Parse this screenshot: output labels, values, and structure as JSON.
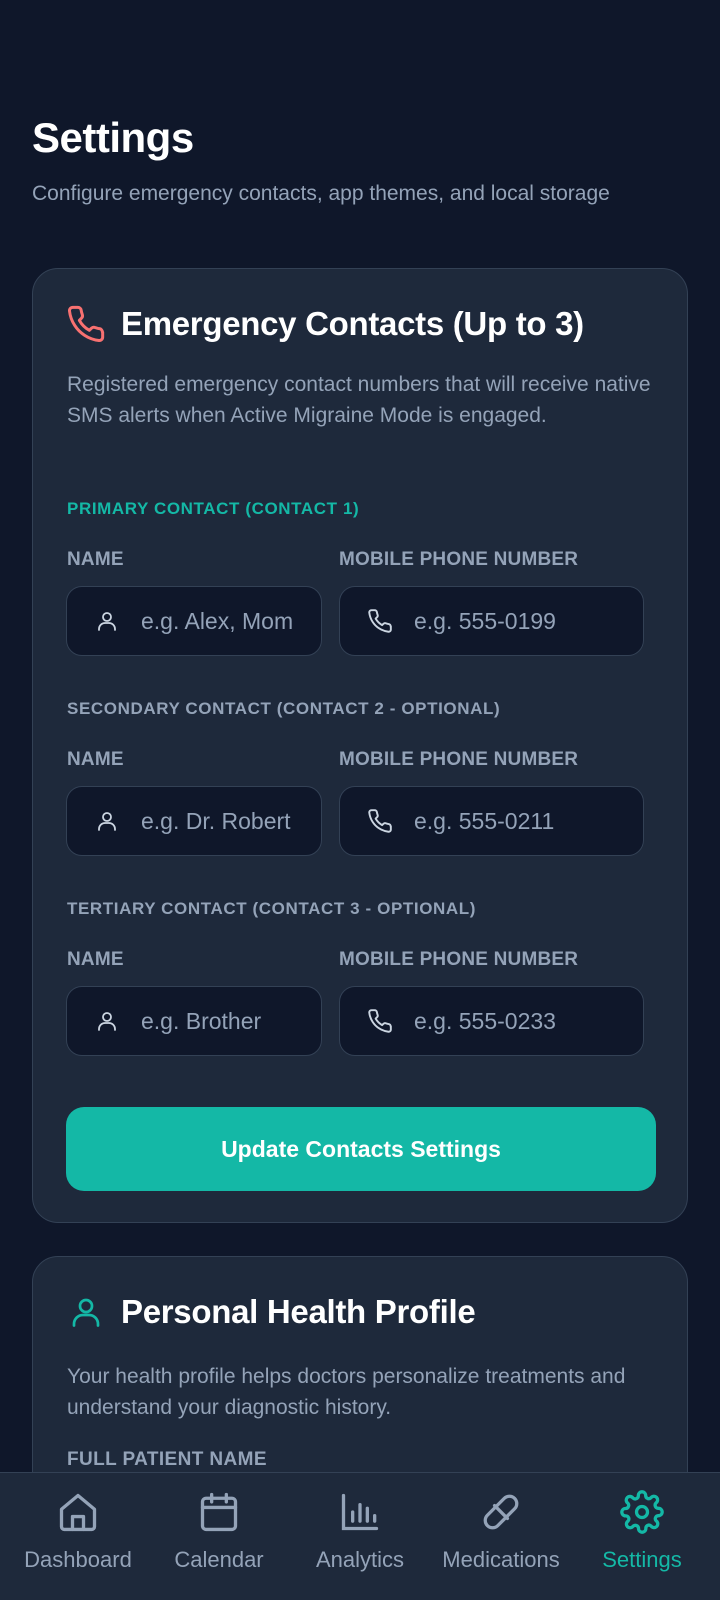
{
  "header": {
    "title": "Settings",
    "subtitle": "Configure emergency contacts, app themes, and local storage"
  },
  "emergency": {
    "title": "Emergency Contacts (Up to 3)",
    "description": "Registered emergency contact numbers that will receive native SMS alerts when Active Migraine Mode is engaged.",
    "contacts": [
      {
        "group_label": "PRIMARY CONTACT (CONTACT 1)",
        "name_label": "NAME",
        "name_placeholder": "e.g. Alex, Mom",
        "name_value": "",
        "phone_label": "MOBILE PHONE NUMBER",
        "phone_placeholder": "e.g. 555-0199",
        "phone_value": ""
      },
      {
        "group_label": "SECONDARY CONTACT (CONTACT 2 - OPTIONAL)",
        "name_label": "NAME",
        "name_placeholder": "e.g. Dr. Robert",
        "name_value": "",
        "phone_label": "MOBILE PHONE NUMBER",
        "phone_placeholder": "e.g. 555-0211",
        "phone_value": ""
      },
      {
        "group_label": "TERTIARY CONTACT (CONTACT 3 - OPTIONAL)",
        "name_label": "NAME",
        "name_placeholder": "e.g. Brother",
        "name_value": "",
        "phone_label": "MOBILE PHONE NUMBER",
        "phone_placeholder": "e.g. 555-0233",
        "phone_value": ""
      }
    ],
    "update_button": "Update Contacts Settings"
  },
  "profile": {
    "title": "Personal Health Profile",
    "description": "Your health profile helps doctors personalize treatments and understand your diagnostic history.",
    "first_field_label": "FULL PATIENT NAME"
  },
  "bottom_nav": {
    "items": [
      {
        "label": "Dashboard",
        "icon": "home-icon"
      },
      {
        "label": "Calendar",
        "icon": "calendar-icon"
      },
      {
        "label": "Analytics",
        "icon": "bar-chart-icon"
      },
      {
        "label": "Medications",
        "icon": "pill-icon"
      },
      {
        "label": "Settings",
        "icon": "gear-icon",
        "active": true
      }
    ]
  },
  "colors": {
    "background": "#0f172a",
    "card": "#1e293b",
    "accent": "#14b8a6",
    "alert_icon": "#f87171",
    "muted_text": "#94a3b8"
  }
}
